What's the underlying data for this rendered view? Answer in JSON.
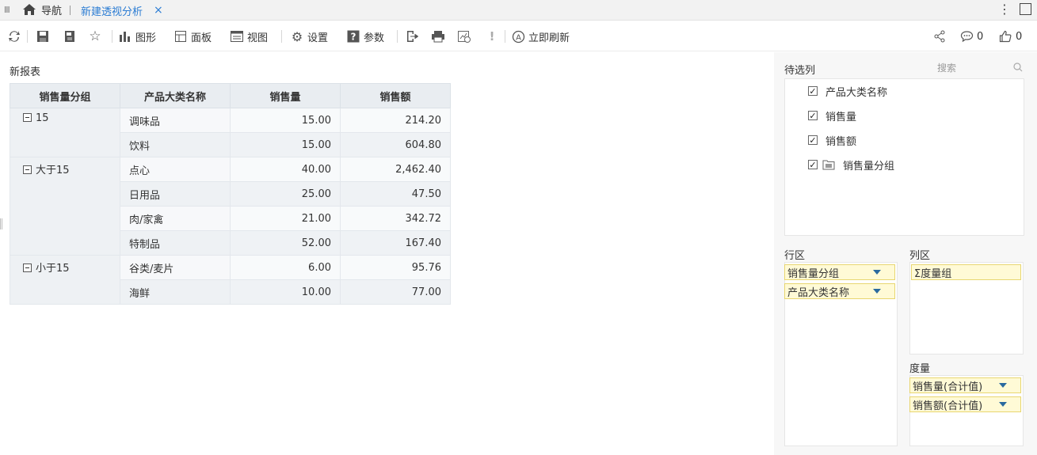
{
  "tabs": {
    "home_label": "导航",
    "active_label": "新建透视分析",
    "close_glyph": "×"
  },
  "toolbar": {
    "chart": "图形",
    "panel": "面板",
    "view": "视图",
    "settings": "设置",
    "params": "参数",
    "refresh": "立即刷新",
    "comments_count": "0",
    "likes_count": "0"
  },
  "report": {
    "title": "新报表",
    "headers": [
      "销售量分组",
      "产品大类名称",
      "销售量",
      "销售额"
    ],
    "groups": [
      {
        "name": "15",
        "rows": [
          {
            "category": "调味品",
            "qty": "15.00",
            "amount": "214.20"
          },
          {
            "category": "饮料",
            "qty": "15.00",
            "amount": "604.80"
          }
        ]
      },
      {
        "name": "大于15",
        "rows": [
          {
            "category": "点心",
            "qty": "40.00",
            "amount": "2,462.40"
          },
          {
            "category": "日用品",
            "qty": "25.00",
            "amount": "47.50"
          },
          {
            "category": "肉/家禽",
            "qty": "21.00",
            "amount": "342.72"
          },
          {
            "category": "特制品",
            "qty": "52.00",
            "amount": "167.40"
          }
        ]
      },
      {
        "name": "小于15",
        "rows": [
          {
            "category": "谷类/麦片",
            "qty": "6.00",
            "amount": "95.76"
          },
          {
            "category": "海鲜",
            "qty": "10.00",
            "amount": "77.00"
          }
        ]
      }
    ]
  },
  "panel": {
    "candidates_title": "待选列",
    "search_placeholder": "搜索",
    "candidates": [
      "产品大类名称",
      "销售量",
      "销售额",
      "销售量分组"
    ],
    "row_zone_title": "行区",
    "row_fields": [
      "销售量分组",
      "产品大类名称"
    ],
    "col_zone_title": "列区",
    "col_fields": [
      "Σ度量组"
    ],
    "measure_title": "度量",
    "measure_fields": [
      "销售量(合计值)",
      "销售额(合计值)"
    ]
  },
  "colors": {
    "accent": "#2b7cd3",
    "pill_bg": "#fffad6",
    "header_bg": "#e9edf1"
  }
}
